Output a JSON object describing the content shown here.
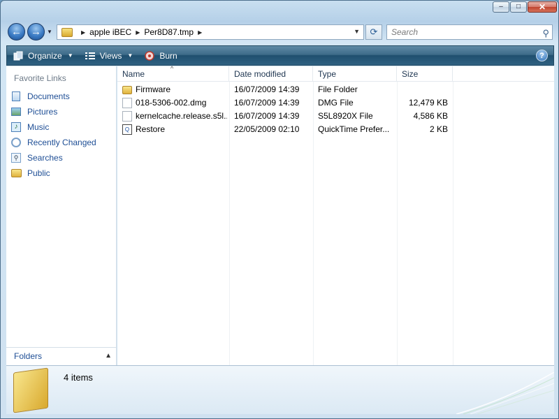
{
  "titlebar": {
    "minimize_label": "–",
    "maximize_label": "□",
    "close_label": "✕"
  },
  "address": {
    "back_icon": "←",
    "forward_icon": "→",
    "dropdown_icon": "▼",
    "crumb_arrow": "▶",
    "crumbs": [
      "apple iBEC",
      "Per8D87.tmp"
    ],
    "refresh_icon": "⟳",
    "search_placeholder": "Search",
    "search_icon": "⚲"
  },
  "toolbar": {
    "organize_label": "Organize",
    "views_label": "Views",
    "burn_label": "Burn",
    "dropdown_icon": "▼",
    "help_label": "?"
  },
  "nav": {
    "heading": "Favorite Links",
    "items": [
      {
        "label": "Documents",
        "icon": "documents-icon"
      },
      {
        "label": "Pictures",
        "icon": "pictures-icon"
      },
      {
        "label": "Music",
        "icon": "music-icon"
      },
      {
        "label": "Recently Changed",
        "icon": "recently-changed-icon"
      },
      {
        "label": "Searches",
        "icon": "searches-icon"
      },
      {
        "label": "Public",
        "icon": "folder-icon"
      }
    ],
    "folders_label": "Folders",
    "folders_chevron": "▲"
  },
  "files": {
    "columns": {
      "name": "Name",
      "date": "Date modified",
      "type": "Type",
      "size": "Size"
    },
    "sort_indicator": "^",
    "rows": [
      {
        "name": "Firmware",
        "date": "16/07/2009 14:39",
        "type": "File Folder",
        "size": "",
        "icon": "folder-icon"
      },
      {
        "name": "018-5306-002.dmg",
        "date": "16/07/2009 14:39",
        "type": "DMG File",
        "size": "12,479 KB",
        "icon": "file-icon"
      },
      {
        "name": "kernelcache.release.s5l...",
        "date": "16/07/2009 14:39",
        "type": "S5L8920X File",
        "size": "4,586 KB",
        "icon": "file-icon"
      },
      {
        "name": "Restore",
        "date": "22/05/2009 02:10",
        "type": "QuickTime Prefer...",
        "size": "2 KB",
        "icon": "restore-icon"
      }
    ]
  },
  "details": {
    "item_count": "4 items"
  }
}
